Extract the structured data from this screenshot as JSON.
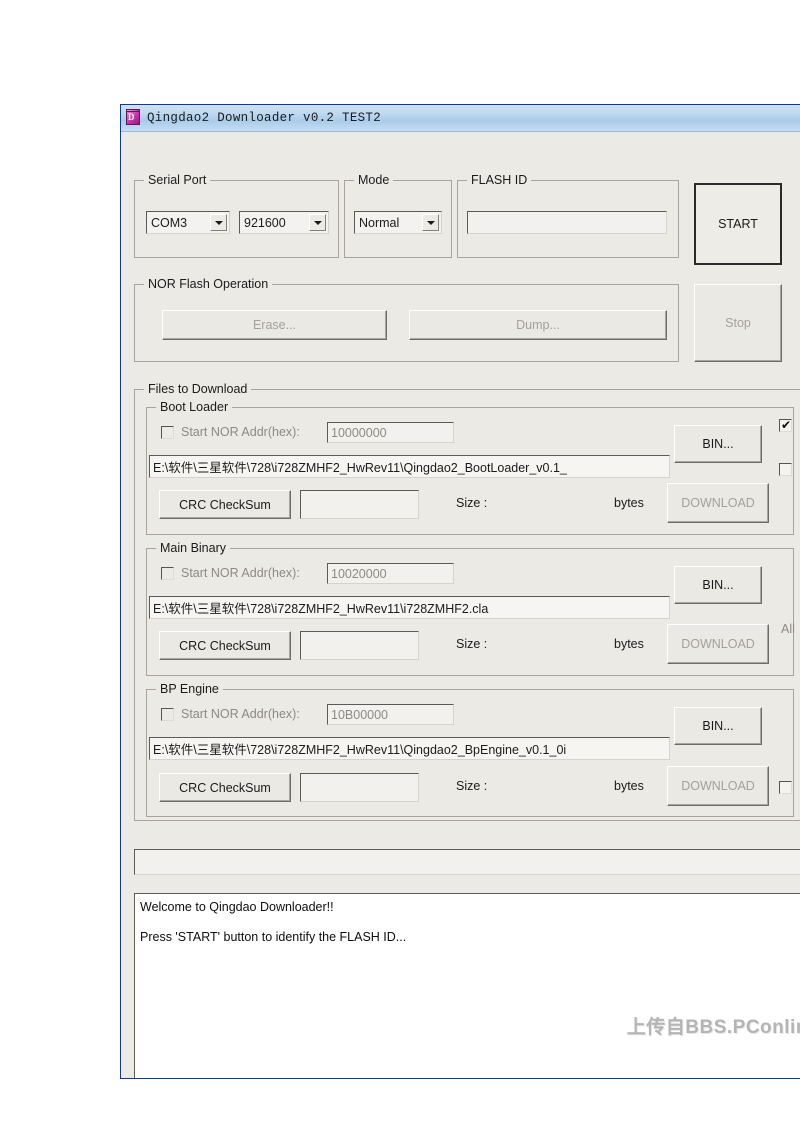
{
  "window": {
    "title": "Qingdao2 Downloader v0.2 TEST2",
    "icon": "app-cube-icon",
    "icon_letter": "D",
    "minimize_label": "minimize-icon"
  },
  "serial_port": {
    "group_label": "Serial Port",
    "port": "COM3",
    "baud": "921600"
  },
  "mode": {
    "group_label": "Mode",
    "value": "Normal"
  },
  "flash_id": {
    "group_label": "FLASH ID",
    "value": ""
  },
  "actions": {
    "start_label": "START",
    "stop_label": "Stop"
  },
  "nor_flash": {
    "group_label": "NOR Flash Operation",
    "erase_label": "Erase...",
    "dump_label": "Dump..."
  },
  "files": {
    "group_label": "Files to Download",
    "all_label": "All",
    "sections": [
      {
        "label": "Boot Loader",
        "addr_label": "Start NOR Addr(hex):",
        "addr_value": "10000000",
        "addr_checked": false,
        "path": "E:\\软件\\三星软件\\728\\i728ZMHF2_HwRev11\\Qingdao2_BootLoader_v0.1_",
        "crc_label": "CRC CheckSum",
        "crc_value": "",
        "size_label": "Size :",
        "size_value": "",
        "bytes_label": "bytes",
        "bin_label": "BIN...",
        "download_label": "DOWNLOAD",
        "select_checked": true
      },
      {
        "label": "Main Binary",
        "addr_label": "Start NOR Addr(hex):",
        "addr_value": "10020000",
        "addr_checked": false,
        "path": "E:\\软件\\三星软件\\728\\i728ZMHF2_HwRev11\\i728ZMHF2.cla",
        "crc_label": "CRC CheckSum",
        "crc_value": "",
        "size_label": "Size :",
        "size_value": "",
        "bytes_label": "bytes",
        "bin_label": "BIN...",
        "download_label": "DOWNLOAD",
        "select_checked": false
      },
      {
        "label": "BP Engine",
        "addr_label": "Start NOR Addr(hex):",
        "addr_value": "10B00000",
        "addr_checked": false,
        "path": "E:\\软件\\三星软件\\728\\i728ZMHF2_HwRev11\\Qingdao2_BpEngine_v0.1_0i",
        "crc_label": "CRC CheckSum",
        "crc_value": "",
        "size_label": "Size :",
        "size_value": "",
        "bytes_label": "bytes",
        "bin_label": "BIN...",
        "download_label": "DOWNLOAD",
        "select_checked": false
      }
    ]
  },
  "status": {
    "value": ""
  },
  "log": {
    "line1": "Welcome to Qingdao Downloader!!",
    "line2": "Press 'START' button to identify the FLASH ID..."
  },
  "watermark": {
    "text": "上传自BBS.PConline"
  }
}
